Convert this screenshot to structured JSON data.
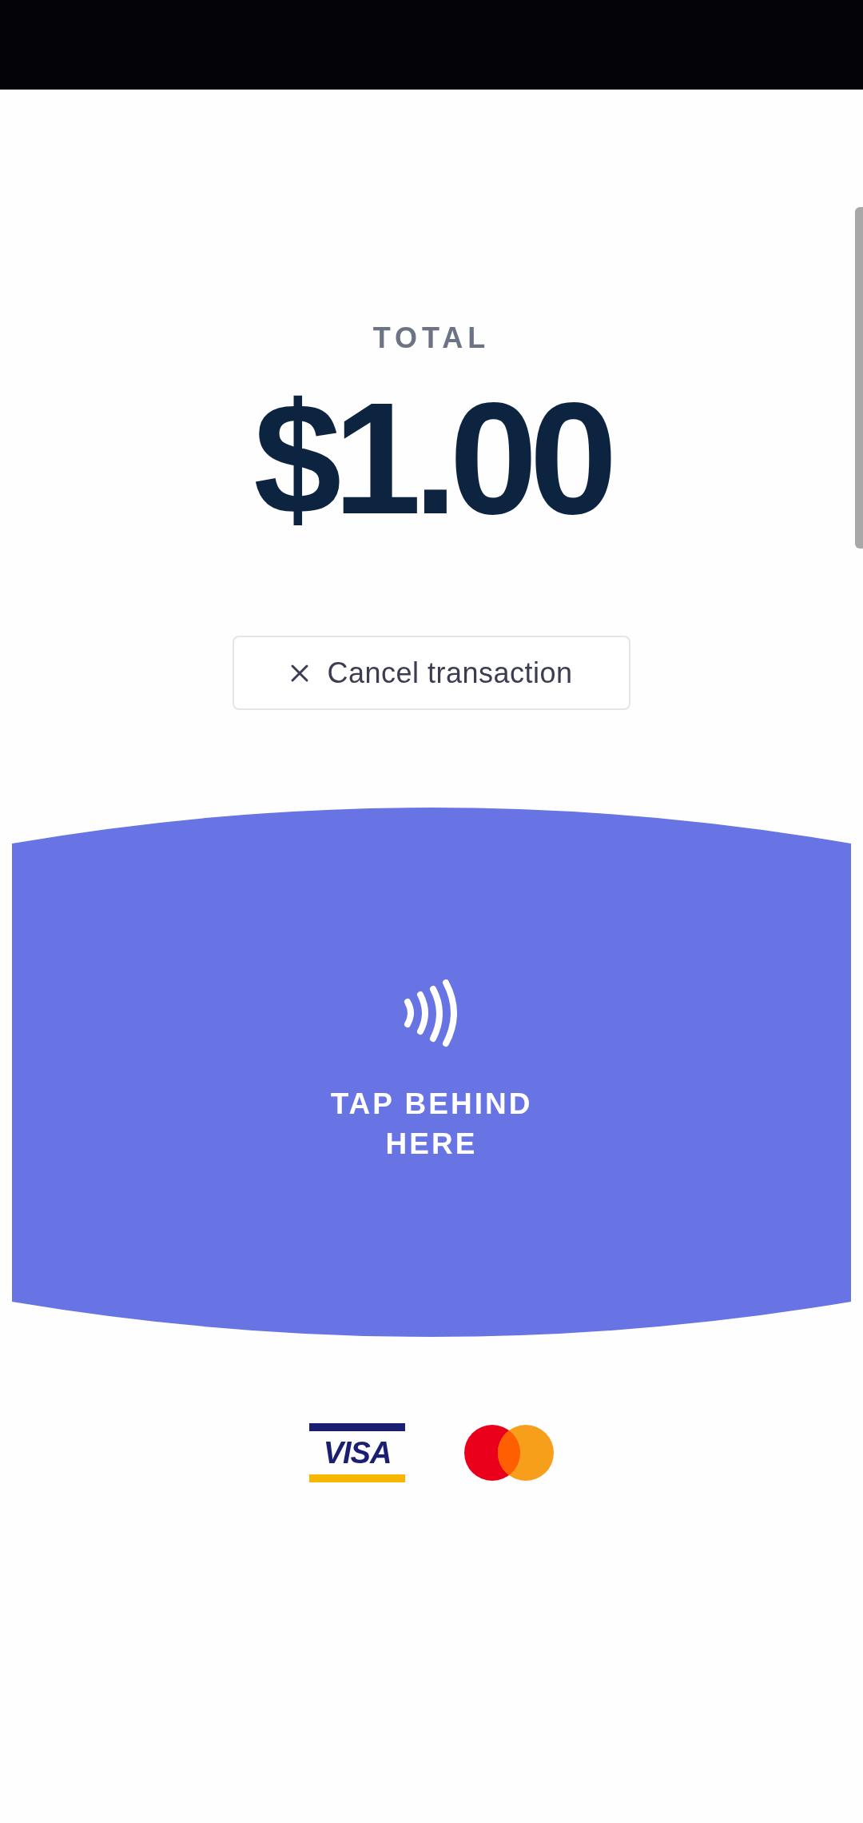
{
  "total_label": "TOTAL",
  "amount": "$1.00",
  "cancel_button": {
    "label": "Cancel transaction"
  },
  "tap_prompt": "TAP BEHIND HERE",
  "card_logos": [
    {
      "kind": "visa",
      "text": "VISA"
    },
    {
      "kind": "mastercard"
    }
  ]
}
